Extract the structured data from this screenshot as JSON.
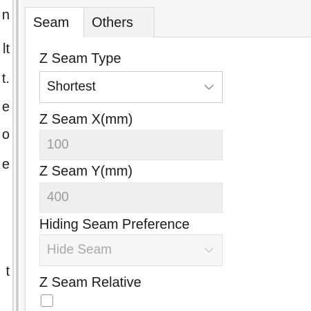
{
  "left_fragments": [
    "n",
    "lt",
    "t.",
    "e",
    "o",
    "e",
    "t"
  ],
  "tabs": [
    {
      "label": "Seam",
      "active": true
    },
    {
      "label": "Others",
      "active": false
    }
  ],
  "settings": {
    "z_seam_type": {
      "label": "Z Seam Type",
      "value": "Shortest",
      "icon": "chevron-down-icon"
    },
    "z_seam_x": {
      "label": "Z Seam X(mm)",
      "value": "100"
    },
    "z_seam_y": {
      "label": "Z Seam Y(mm)",
      "value": "400"
    },
    "hiding_seam_preference": {
      "label": "Hiding Seam Preference",
      "value": "Hide Seam",
      "disabled": true,
      "icon": "chevron-down-icon"
    },
    "z_seam_relative": {
      "label": "Z Seam Relative",
      "checked": false
    }
  },
  "colors": {
    "panel_bg": "#f7f7f7",
    "content_bg": "#ffffff",
    "border": "#d5d5d5",
    "disabled_text": "#a9a9a9"
  }
}
